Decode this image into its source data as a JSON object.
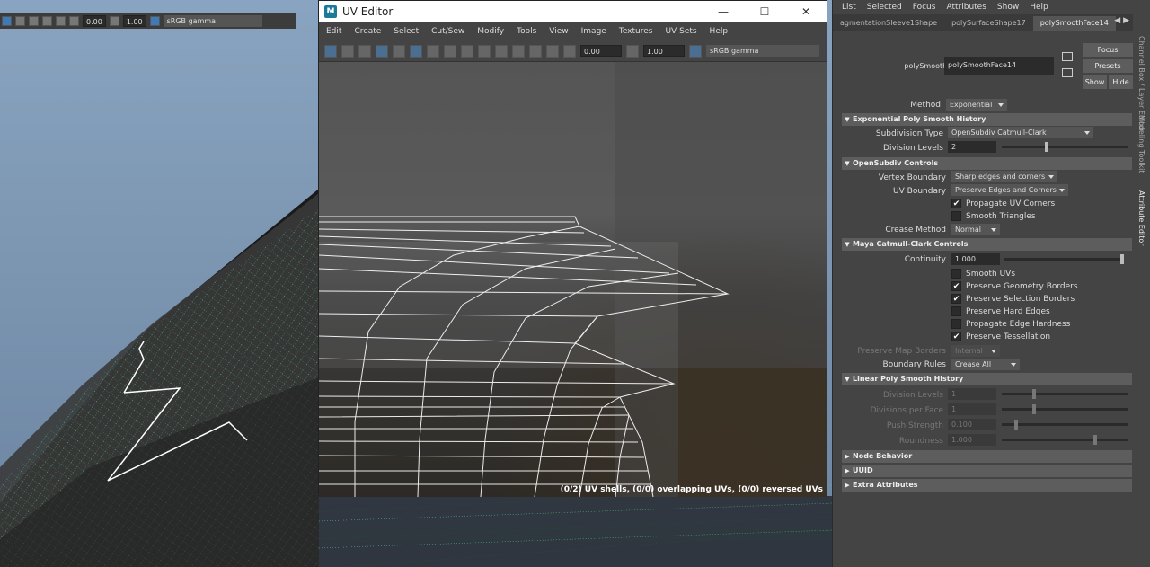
{
  "viewport": {
    "toolbar": {
      "value1": "0.00",
      "value2": "1.00",
      "colorspace": "sRGB gamma"
    }
  },
  "uv_editor": {
    "title": "UV Editor",
    "window_controls": [
      "—",
      "☐",
      "✕"
    ],
    "menu": [
      "Edit",
      "Create",
      "Select",
      "Cut/Sew",
      "Modify",
      "Tools",
      "View",
      "Image",
      "Textures",
      "UV Sets",
      "Help"
    ],
    "toolbar": {
      "value1": "0.00",
      "value2": "1.00",
      "colorspace": "sRGB gamma"
    },
    "status": "(0/2) UV shells, (0/0) overlapping UVs, (0/0) reversed UVs"
  },
  "attribute_editor": {
    "menu": [
      "List",
      "Selected",
      "Focus",
      "Attributes",
      "Show",
      "Help"
    ],
    "tabs": [
      "agmentationSleeve1Shape",
      "polySurfaceShape17",
      "polySmoothFace14"
    ],
    "active_tab": "polySmoothFace14",
    "node_label": "polySmoothFace:",
    "node_value": "polySmoothFace14",
    "buttons": {
      "focus": "Focus",
      "presets": "Presets",
      "show": "Show",
      "hide": "Hide"
    },
    "method": {
      "label": "Method",
      "value": "Exponential"
    },
    "exp_section": "Exponential Poly Smooth History",
    "subdivision_type": {
      "label": "Subdivision Type",
      "value": "OpenSubdiv Catmull-Clark"
    },
    "division_levels": {
      "label": "Division Levels",
      "value": "2",
      "fraction": 0.35
    },
    "osd_section": "OpenSubdiv Controls",
    "vertex_boundary": {
      "label": "Vertex Boundary",
      "value": "Sharp edges and corners"
    },
    "uv_boundary": {
      "label": "UV Boundary",
      "value": "Preserve Edges and Corners"
    },
    "propagate_uv_corners": {
      "label": "Propagate UV Corners",
      "checked": true
    },
    "smooth_triangles": {
      "label": "Smooth Triangles",
      "checked": false
    },
    "crease_method": {
      "label": "Crease Method",
      "value": "Normal"
    },
    "maya_section": "Maya Catmull-Clark Controls",
    "continuity": {
      "label": "Continuity",
      "value": "1.000",
      "fraction": 1.0
    },
    "smooth_uvs": {
      "label": "Smooth UVs",
      "checked": false
    },
    "preserve_geometry_borders": {
      "label": "Preserve Geometry Borders",
      "checked": true
    },
    "preserve_selection_borders": {
      "label": "Preserve Selection Borders",
      "checked": true
    },
    "preserve_hard_edges": {
      "label": "Preserve Hard Edges",
      "checked": false
    },
    "propagate_edge_hardness": {
      "label": "Propagate Edge Hardness",
      "checked": false
    },
    "preserve_tessellation": {
      "label": "Preserve Tessellation",
      "checked": true
    },
    "preserve_map_borders": {
      "label": "Preserve Map Borders",
      "value": "Internal"
    },
    "boundary_rules": {
      "label": "Boundary Rules",
      "value": "Crease All"
    },
    "linear_section": "Linear Poly Smooth History",
    "lin_division_levels": {
      "label": "Division Levels",
      "value": "1",
      "fraction": 0.25
    },
    "divisions_per_face": {
      "label": "Divisions per Face",
      "value": "1",
      "fraction": 0.25
    },
    "push_strength": {
      "label": "Push Strength",
      "value": "0.100",
      "fraction": 0.1
    },
    "roundness": {
      "label": "Roundness",
      "value": "1.000",
      "fraction": 0.75
    },
    "node_behavior": "Node Behavior",
    "uuid": "UUID",
    "extra_attributes": "Extra Attributes"
  },
  "side_tabs": [
    "Channel Box / Layer Editor",
    "Modeling Toolkit",
    "Attribute Editor"
  ]
}
